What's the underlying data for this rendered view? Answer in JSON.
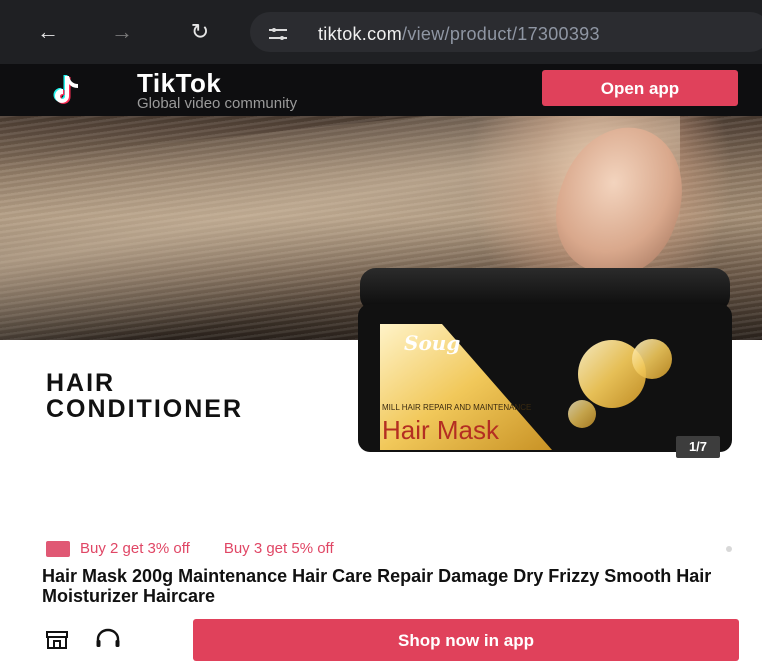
{
  "browser": {
    "back_icon": "←",
    "forward_icon": "→",
    "reload_icon": "↻",
    "url_host": "tiktok.com",
    "url_path": "/view/product/17300393"
  },
  "header": {
    "brand_name": "TikTok",
    "tagline": "Global video community",
    "open_app_label": "Open app"
  },
  "hero": {
    "overlay_title_line1": "HAIR",
    "overlay_title_line2": "CONDITIONER",
    "jar_brand": "Soug",
    "jar_subtitle": "MILL HAIR REPAIR AND MAINTENANCE",
    "jar_title": "Hair Mask",
    "image_counter": "1/7"
  },
  "product": {
    "promo_1": "Buy 2 get 3% off",
    "promo_2": "Buy 3 get 5% off",
    "name": "Hair Mask 200g Maintenance Hair Care Repair Damage Dry Frizzy Smooth Hair Moisturizer Haircare"
  },
  "footer": {
    "shop_now_label": "Shop now in app"
  },
  "colors": {
    "accent": "#e0415b",
    "promo_text": "#e04665",
    "header_bg": "#0e0e10",
    "browser_bg": "#1f2023"
  },
  "icons": {
    "back": "arrow-left-icon",
    "forward": "arrow-right-icon",
    "reload": "reload-icon",
    "site_settings": "tune-icon",
    "brand": "tiktok-logo-icon",
    "shop": "shop-icon",
    "support": "headset-icon"
  }
}
